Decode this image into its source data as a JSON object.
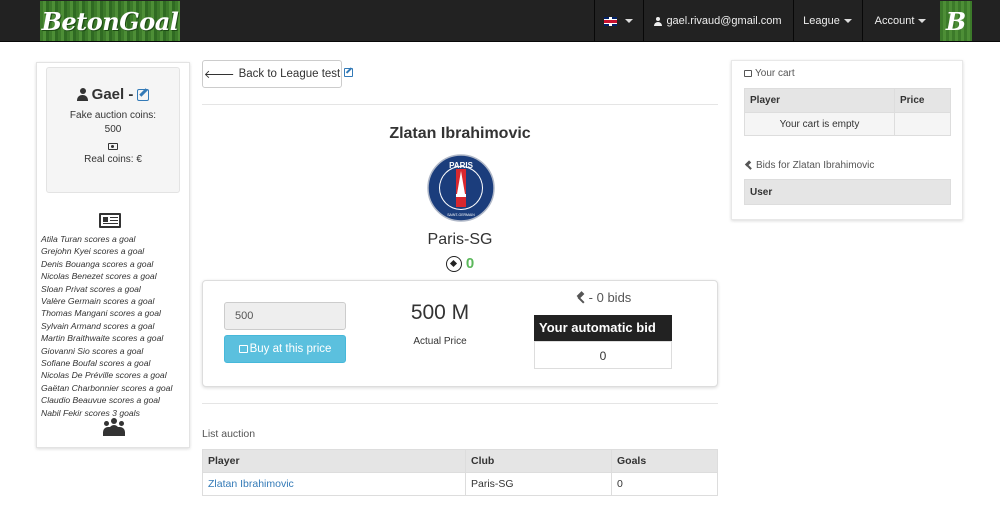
{
  "navbar": {
    "brand": "BetonGoal",
    "language_flag": "flag-uk-icon",
    "email": "gael.rivaud@gmail.com",
    "league_label": "League",
    "account_label": "Account",
    "logo_letter": "B"
  },
  "profile": {
    "name": "Gael -",
    "fake_coins_label": "Fake auction coins:",
    "fake_coins_value": "500",
    "real_coins_label": "Real coins: €"
  },
  "news": [
    "Atila Turan scores a goal",
    "Grejohn Kyei scores a goal",
    "Denis Bouanga scores a goal",
    "Nicolas Benezet scores a goal",
    "Sloan Privat scores a goal",
    "Valère Germain scores a goal",
    "Thomas Mangani scores a goal",
    "Sylvain Armand scores a goal",
    "Martin Braithwaite scores a goal",
    "Giovanni Sio scores a goal",
    "Sofiane Boufal scores a goal",
    "Nicolas De Préville scores a goal",
    "Gaëtan Charbonnier scores a goal",
    "Claudio Beauvue scores a goal",
    "Nabil Fekir scores 3 goals"
  ],
  "main": {
    "back_button": "Back to League test",
    "player_name": "Zlatan Ibrahimovic",
    "club_name": "Paris-SG",
    "club_logo_text": "PARIS",
    "club_logo_subtext": "SAINT-GERMAIN",
    "goals": "0",
    "price_input_value": "500",
    "buy_button": "Buy at this price",
    "price": "500 M",
    "price_label": "Actual Price",
    "bids_count": "- 0 bids",
    "auto_bid_header": "Your automatic bid",
    "auto_bid_value": "0"
  },
  "list_auction": {
    "label": "List auction",
    "columns": [
      "Player",
      "Club",
      "Goals"
    ],
    "rows": [
      [
        "Zlatan Ibrahimovic",
        "Paris-SG",
        "0"
      ]
    ]
  },
  "cart": {
    "title": "Your cart",
    "columns": [
      "Player",
      "Price"
    ],
    "empty_text": "Your cart is empty"
  },
  "bids": {
    "title": "Bids for Zlatan Ibrahimovic",
    "columns": [
      "User"
    ]
  },
  "colors": {
    "accent_link": "#337ab7",
    "buy_button": "#5bc0de",
    "goals_green": "#5cb85c",
    "navbar": "#222222"
  }
}
